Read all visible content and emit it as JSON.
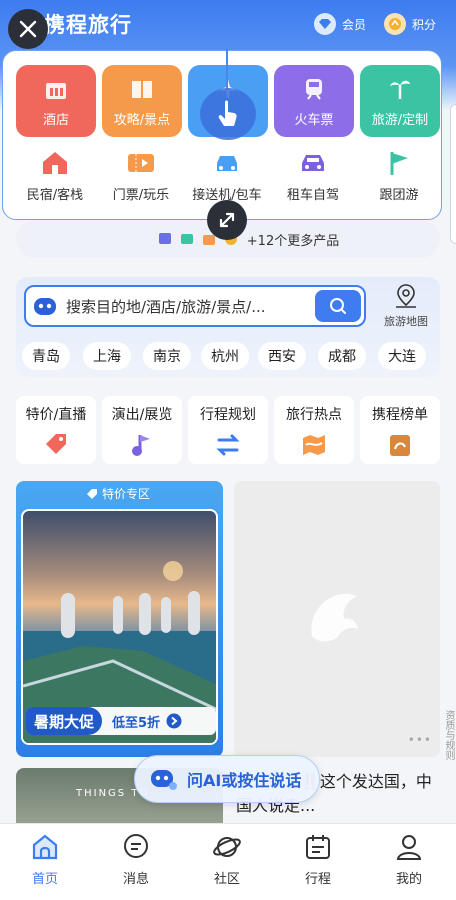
{
  "header": {
    "logo": "携程旅行",
    "member": "会员",
    "points": "积分"
  },
  "big_tiles": [
    {
      "label": "酒店",
      "color": "#f0675b"
    },
    {
      "label": "攻略/景点",
      "color": "#f59a4a"
    },
    {
      "label": "",
      "color": "#4a9ff5"
    },
    {
      "label": "火车票",
      "color": "#8e6ee8"
    },
    {
      "label": "旅游/定制",
      "color": "#3cc3a3"
    }
  ],
  "small_items": [
    "民宿/客栈",
    "门票/玩乐",
    "接送机/包车",
    "租车自驾",
    "跟团游"
  ],
  "more": {
    "label": "+12个更多产品"
  },
  "search": {
    "placeholder": "搜索目的地/酒店/旅游/景点/...",
    "map_label": "旅游地图"
  },
  "cities": [
    "青岛",
    "上海",
    "南京",
    "杭州",
    "西安",
    "成都",
    "大连"
  ],
  "quick_tiles": [
    "特价/直播",
    "演出/展览",
    "行程规划",
    "旅行热点",
    "携程榜单"
  ],
  "promo": {
    "tag": "特价专区",
    "left": "暑期大促",
    "right": "低至5折"
  },
  "side_text": "资质与规则",
  "feed": {
    "text": "又升职了‼️这个发达国，中国人说走...",
    "image_text": "THINGS TO"
  },
  "ai": {
    "label": "问AI或按住说话"
  },
  "tabs": [
    "首页",
    "消息",
    "社区",
    "行程",
    "我的"
  ],
  "colors": {
    "brand": "#3b7cf0"
  }
}
